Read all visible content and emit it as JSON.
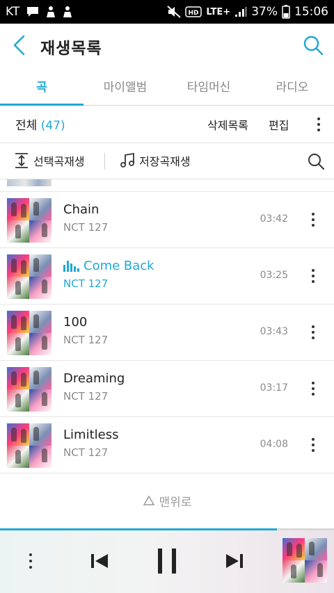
{
  "status_bar": {
    "carrier": "KT",
    "battery_percent": "37%",
    "time": "15:06",
    "network": "LTE+",
    "hd_label": "HD",
    "icons": [
      "chat-icon",
      "person-icon",
      "person-icon",
      "mute-icon",
      "hd-icon",
      "lte-icon",
      "signal-icon",
      "battery-icon"
    ]
  },
  "header": {
    "title": "재생목록",
    "back_icon": "chevron-left-icon",
    "search_icon": "search-icon"
  },
  "tabs": [
    {
      "label": "곡",
      "active": true
    },
    {
      "label": "마이앨범",
      "active": false
    },
    {
      "label": "타임머신",
      "active": false
    },
    {
      "label": "라디오",
      "active": false
    }
  ],
  "summary": {
    "total_label": "전체",
    "count": "(47)",
    "delete_label": "삭제목록",
    "edit_label": "편집"
  },
  "actions": {
    "play_selected_label": "선택곡재생",
    "play_saved_label": "저장곡재생"
  },
  "songs": [
    {
      "title": "Chain",
      "artist": "NCT 127",
      "duration": "03:42",
      "playing": false
    },
    {
      "title": "Come Back",
      "artist": "NCT 127",
      "duration": "03:25",
      "playing": true
    },
    {
      "title": "100",
      "artist": "NCT 127",
      "duration": "03:43",
      "playing": false
    },
    {
      "title": "Dreaming",
      "artist": "NCT 127",
      "duration": "03:17",
      "playing": false
    },
    {
      "title": "Limitless",
      "artist": "NCT 127",
      "duration": "04:08",
      "playing": false
    }
  ],
  "scroll_to_top": {
    "label": "맨위로",
    "icon": "triangle-up-icon"
  },
  "player": {
    "progress_fraction": 0.83,
    "colors": {
      "accent": "#1fa9d6"
    }
  },
  "colors": {
    "accent": "#1fa9d6",
    "text_primary": "#222222",
    "text_secondary": "#8a8a8a"
  }
}
